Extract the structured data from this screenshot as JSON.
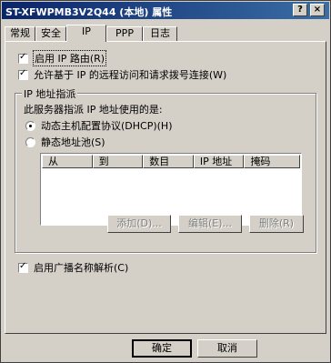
{
  "window": {
    "title": "ST-XFWPMB3V2Q44 (本地) 属性"
  },
  "titlebar_buttons": {
    "help": "?",
    "close": "×"
  },
  "tabs": [
    "常规",
    "安全",
    "IP",
    "PPP",
    "日志"
  ],
  "active_tab": "IP",
  "options": {
    "enable_ip_routing": {
      "label": "启用 IP 路由(R)",
      "checked": true
    },
    "allow_ip_remote": {
      "label": "允许基于 IP 的远程访问和请求拨号连接(W)",
      "checked": true
    }
  },
  "ip_assignment": {
    "group_label": "IP 地址指派",
    "desc": "此服务器指派 IP 地址使用的是:",
    "dhcp_label": "动态主机配置协议(DHCP)(H)",
    "static_pool_label": "静态地址池(S)",
    "selected": "dhcp",
    "columns": [
      "从",
      "到",
      "数目",
      "IP 地址",
      "掩码"
    ]
  },
  "pool_buttons": {
    "add": "添加(D)...",
    "edit": "编辑(E)...",
    "remove": "删除(R)"
  },
  "broadcast": {
    "label": "启用广播名称解析(C)",
    "checked": true
  },
  "footer": {
    "ok": "确定",
    "cancel": "取消"
  }
}
